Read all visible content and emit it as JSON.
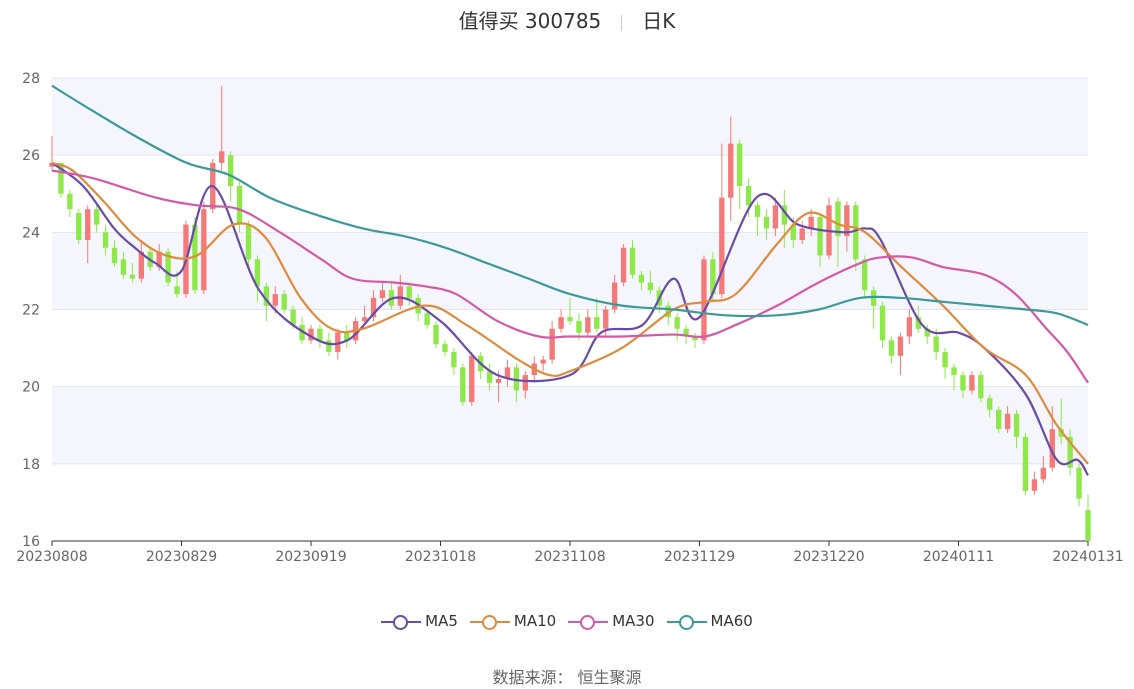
{
  "header": {
    "title": "值得买 300785",
    "period": "日K"
  },
  "source_text": "数据来源： 恒生聚源",
  "colors": {
    "up": "#f47a7a",
    "down": "#8ee84a",
    "MA5": "#6a4aa8",
    "MA10": "#e08a3c",
    "MA30": "#d45aa8",
    "MA60": "#3a9a9a"
  },
  "chart_data": {
    "type": "candlestick",
    "ylim": [
      16,
      28
    ],
    "y_ticks": [
      "16",
      "18",
      "20",
      "22",
      "24",
      "26",
      "28"
    ],
    "x_ticks": [
      "20230808",
      "20230829",
      "20230919",
      "20231018",
      "20231108",
      "20231129",
      "20231220",
      "20240111",
      "20240131"
    ],
    "grid": "horizontal bands",
    "legend": [
      "MA5",
      "MA10",
      "MA30",
      "MA60"
    ],
    "legend_position": "bottom",
    "candles": [
      [
        25.7,
        25.8,
        26.5,
        25.6
      ],
      [
        25.8,
        25.0,
        25.8,
        24.9
      ],
      [
        25.0,
        24.6,
        25.1,
        24.4
      ],
      [
        24.5,
        23.8,
        24.6,
        23.7
      ],
      [
        23.8,
        24.6,
        24.7,
        23.2
      ],
      [
        24.6,
        24.2,
        24.7,
        24.0
      ],
      [
        24.0,
        23.6,
        24.2,
        23.4
      ],
      [
        23.6,
        23.2,
        23.8,
        23.1
      ],
      [
        23.3,
        22.9,
        23.5,
        22.8
      ],
      [
        22.9,
        22.8,
        23.2,
        22.7
      ],
      [
        22.8,
        23.5,
        23.8,
        22.7
      ],
      [
        23.5,
        23.1,
        23.6,
        23.0
      ],
      [
        23.1,
        23.5,
        23.7,
        23.0
      ],
      [
        23.5,
        22.7,
        23.6,
        22.6
      ],
      [
        22.6,
        22.4,
        23.0,
        22.3
      ],
      [
        22.4,
        24.2,
        24.3,
        22.3
      ],
      [
        24.2,
        22.5,
        24.4,
        22.4
      ],
      [
        22.5,
        24.6,
        24.8,
        22.4
      ],
      [
        24.6,
        25.8,
        25.9,
        24.5
      ],
      [
        25.8,
        26.1,
        27.8,
        25.6
      ],
      [
        26.0,
        25.2,
        26.1,
        24.8
      ],
      [
        25.2,
        24.2,
        25.3,
        24.0
      ],
      [
        24.2,
        23.3,
        24.3,
        23.1
      ],
      [
        23.3,
        22.6,
        23.4,
        22.2
      ],
      [
        22.6,
        22.1,
        22.7,
        21.7
      ],
      [
        22.1,
        22.4,
        22.6,
        21.9
      ],
      [
        22.4,
        22.0,
        22.5,
        21.9
      ],
      [
        22.0,
        21.6,
        22.1,
        21.5
      ],
      [
        21.6,
        21.2,
        21.8,
        21.1
      ],
      [
        21.2,
        21.5,
        21.6,
        21.1
      ],
      [
        21.5,
        21.2,
        21.6,
        21.0
      ],
      [
        21.2,
        20.9,
        21.4,
        20.8
      ],
      [
        20.9,
        21.4,
        21.5,
        20.7
      ],
      [
        21.4,
        21.2,
        21.6,
        21.0
      ],
      [
        21.2,
        21.7,
        21.8,
        21.1
      ],
      [
        21.7,
        21.8,
        22.1,
        21.6
      ],
      [
        21.8,
        22.3,
        22.5,
        21.7
      ],
      [
        22.3,
        22.5,
        22.7,
        22.2
      ],
      [
        22.5,
        22.1,
        22.7,
        22.0
      ],
      [
        22.1,
        22.6,
        22.9,
        22.0
      ],
      [
        22.6,
        22.3,
        22.7,
        22.1
      ],
      [
        22.3,
        21.9,
        22.4,
        21.7
      ],
      [
        21.9,
        21.6,
        22.0,
        21.5
      ],
      [
        21.6,
        21.1,
        21.7,
        21.0
      ],
      [
        21.1,
        20.9,
        21.2,
        20.8
      ],
      [
        20.9,
        20.5,
        21.0,
        20.3
      ],
      [
        20.5,
        19.6,
        20.6,
        19.5
      ],
      [
        19.6,
        20.8,
        20.9,
        19.5
      ],
      [
        20.8,
        20.4,
        20.9,
        20.2
      ],
      [
        20.4,
        20.1,
        20.6,
        19.9
      ],
      [
        20.1,
        20.2,
        20.4,
        19.6
      ],
      [
        20.2,
        20.5,
        20.7,
        20.0
      ],
      [
        20.5,
        19.9,
        20.6,
        19.6
      ],
      [
        19.9,
        20.3,
        20.4,
        19.7
      ],
      [
        20.3,
        20.6,
        20.8,
        20.1
      ],
      [
        20.6,
        20.7,
        20.8,
        20.4
      ],
      [
        20.7,
        21.5,
        21.7,
        20.6
      ],
      [
        21.5,
        21.8,
        22.0,
        21.4
      ],
      [
        21.8,
        21.7,
        22.3,
        21.6
      ],
      [
        21.7,
        21.4,
        21.9,
        21.2
      ],
      [
        21.4,
        21.8,
        22.0,
        21.3
      ],
      [
        21.8,
        21.5,
        22.3,
        21.4
      ],
      [
        21.5,
        22.0,
        22.1,
        21.3
      ],
      [
        22.0,
        22.7,
        22.9,
        21.9
      ],
      [
        22.7,
        23.6,
        23.7,
        22.6
      ],
      [
        23.6,
        22.9,
        23.8,
        22.8
      ],
      [
        22.9,
        22.7,
        23.0,
        22.5
      ],
      [
        22.7,
        22.5,
        23.0,
        22.4
      ],
      [
        22.5,
        22.1,
        22.6,
        21.9
      ],
      [
        22.1,
        21.8,
        22.2,
        21.6
      ],
      [
        21.8,
        21.5,
        21.9,
        21.2
      ],
      [
        21.5,
        21.3,
        21.6,
        21.1
      ],
      [
        21.3,
        21.2,
        21.4,
        21.0
      ],
      [
        21.2,
        23.3,
        23.4,
        21.1
      ],
      [
        23.3,
        22.4,
        23.5,
        22.2
      ],
      [
        22.4,
        24.9,
        26.3,
        22.3
      ],
      [
        24.9,
        26.3,
        27.0,
        24.3
      ],
      [
        26.3,
        25.2,
        26.4,
        24.6
      ],
      [
        25.2,
        24.7,
        25.4,
        24.4
      ],
      [
        24.7,
        24.4,
        24.8,
        23.9
      ],
      [
        24.4,
        24.1,
        24.6,
        23.8
      ],
      [
        24.1,
        24.7,
        24.9,
        23.9
      ],
      [
        24.7,
        24.2,
        25.1,
        23.6
      ],
      [
        24.2,
        23.8,
        24.4,
        23.6
      ],
      [
        23.8,
        24.1,
        24.3,
        23.7
      ],
      [
        24.1,
        24.4,
        24.6,
        23.9
      ],
      [
        24.4,
        23.4,
        24.5,
        23.1
      ],
      [
        23.4,
        24.7,
        24.9,
        23.3
      ],
      [
        24.8,
        23.9,
        24.9,
        23.1
      ],
      [
        23.9,
        24.7,
        24.8,
        23.5
      ],
      [
        24.7,
        23.3,
        24.8,
        23.0
      ],
      [
        23.3,
        22.5,
        23.4,
        22.3
      ],
      [
        22.5,
        22.1,
        22.6,
        21.5
      ],
      [
        22.1,
        21.2,
        22.2,
        21.0
      ],
      [
        21.2,
        20.8,
        21.3,
        20.6
      ],
      [
        20.8,
        21.3,
        21.4,
        20.3
      ],
      [
        21.3,
        21.8,
        22.0,
        21.1
      ],
      [
        21.8,
        21.5,
        22.1,
        21.4
      ],
      [
        21.5,
        21.3,
        21.6,
        21.1
      ],
      [
        21.3,
        20.9,
        21.5,
        20.7
      ],
      [
        20.9,
        20.5,
        21.0,
        20.2
      ],
      [
        20.5,
        20.3,
        20.6,
        19.9
      ],
      [
        20.3,
        19.9,
        20.4,
        19.7
      ],
      [
        19.9,
        20.3,
        20.4,
        19.8
      ],
      [
        20.3,
        19.7,
        20.4,
        19.6
      ],
      [
        19.7,
        19.4,
        19.8,
        19.2
      ],
      [
        19.4,
        18.9,
        19.5,
        18.8
      ],
      [
        18.9,
        19.3,
        19.5,
        18.8
      ],
      [
        19.3,
        18.7,
        19.4,
        18.4
      ],
      [
        18.7,
        17.3,
        18.8,
        17.2
      ],
      [
        17.3,
        17.6,
        17.8,
        17.2
      ],
      [
        17.6,
        17.9,
        18.2,
        17.5
      ],
      [
        17.9,
        18.9,
        19.5,
        17.8
      ],
      [
        18.9,
        18.7,
        19.7,
        18.5
      ],
      [
        18.7,
        17.9,
        18.9,
        17.7
      ],
      [
        17.9,
        17.1,
        18.0,
        16.9
      ],
      [
        16.8,
        16.0,
        17.2,
        16.0
      ]
    ],
    "series": [
      {
        "name": "MA5",
        "values": [
          [
            0,
            25.8
          ],
          [
            0.03,
            25.2
          ],
          [
            0.06,
            24.1
          ],
          [
            0.08,
            23.6
          ],
          [
            0.1,
            23.2
          ],
          [
            0.125,
            23.0
          ],
          [
            0.155,
            25.2
          ],
          [
            0.2,
            22.5
          ],
          [
            0.25,
            21.3
          ],
          [
            0.285,
            21.2
          ],
          [
            0.33,
            22.3
          ],
          [
            0.375,
            21.7
          ],
          [
            0.43,
            20.3
          ],
          [
            0.5,
            20.3
          ],
          [
            0.53,
            21.4
          ],
          [
            0.57,
            21.6
          ],
          [
            0.6,
            22.8
          ],
          [
            0.625,
            21.8
          ],
          [
            0.68,
            24.9
          ],
          [
            0.72,
            24.2
          ],
          [
            0.765,
            24.0
          ],
          [
            0.785,
            24.1
          ],
          [
            0.8,
            23.8
          ],
          [
            0.84,
            21.6
          ],
          [
            0.875,
            21.4
          ],
          [
            0.9,
            21.0
          ],
          [
            0.94,
            19.8
          ],
          [
            0.97,
            18.1
          ],
          [
            0.99,
            18.1
          ],
          [
            1.0,
            17.7
          ]
        ]
      },
      {
        "name": "MA10",
        "values": [
          [
            0,
            25.8
          ],
          [
            0.02,
            25.6
          ],
          [
            0.05,
            24.8
          ],
          [
            0.08,
            23.9
          ],
          [
            0.11,
            23.4
          ],
          [
            0.14,
            23.4
          ],
          [
            0.175,
            24.2
          ],
          [
            0.205,
            23.9
          ],
          [
            0.24,
            22.3
          ],
          [
            0.27,
            21.5
          ],
          [
            0.3,
            21.5
          ],
          [
            0.36,
            22.1
          ],
          [
            0.4,
            21.6
          ],
          [
            0.45,
            20.7
          ],
          [
            0.48,
            20.3
          ],
          [
            0.5,
            20.4
          ],
          [
            0.55,
            21.0
          ],
          [
            0.6,
            22.0
          ],
          [
            0.63,
            22.2
          ],
          [
            0.66,
            22.4
          ],
          [
            0.7,
            23.7
          ],
          [
            0.73,
            24.5
          ],
          [
            0.76,
            24.2
          ],
          [
            0.785,
            24.0
          ],
          [
            0.82,
            23.1
          ],
          [
            0.86,
            22.1
          ],
          [
            0.9,
            21.0
          ],
          [
            0.94,
            20.3
          ],
          [
            0.97,
            19.0
          ],
          [
            1.0,
            18.0
          ]
        ]
      },
      {
        "name": "MA30",
        "values": [
          [
            0,
            25.6
          ],
          [
            0.04,
            25.4
          ],
          [
            0.1,
            24.9
          ],
          [
            0.14,
            24.7
          ],
          [
            0.18,
            24.6
          ],
          [
            0.22,
            24.0
          ],
          [
            0.26,
            23.3
          ],
          [
            0.29,
            22.8
          ],
          [
            0.33,
            22.7
          ],
          [
            0.36,
            22.6
          ],
          [
            0.39,
            22.4
          ],
          [
            0.43,
            21.7
          ],
          [
            0.47,
            21.3
          ],
          [
            0.5,
            21.3
          ],
          [
            0.55,
            21.3
          ],
          [
            0.6,
            21.35
          ],
          [
            0.63,
            21.3
          ],
          [
            0.66,
            21.6
          ],
          [
            0.7,
            22.1
          ],
          [
            0.74,
            22.7
          ],
          [
            0.78,
            23.2
          ],
          [
            0.8,
            23.35
          ],
          [
            0.83,
            23.35
          ],
          [
            0.86,
            23.1
          ],
          [
            0.9,
            22.9
          ],
          [
            0.93,
            22.4
          ],
          [
            0.96,
            21.5
          ],
          [
            0.98,
            20.9
          ],
          [
            1.0,
            20.1
          ]
        ]
      },
      {
        "name": "MA60",
        "values": [
          [
            0,
            27.8
          ],
          [
            0.03,
            27.3
          ],
          [
            0.08,
            26.5
          ],
          [
            0.13,
            25.8
          ],
          [
            0.17,
            25.5
          ],
          [
            0.21,
            24.9
          ],
          [
            0.25,
            24.5
          ],
          [
            0.3,
            24.1
          ],
          [
            0.34,
            23.9
          ],
          [
            0.38,
            23.6
          ],
          [
            0.42,
            23.2
          ],
          [
            0.46,
            22.8
          ],
          [
            0.5,
            22.4
          ],
          [
            0.55,
            22.1
          ],
          [
            0.6,
            22.0
          ],
          [
            0.65,
            21.85
          ],
          [
            0.7,
            21.85
          ],
          [
            0.74,
            22.0
          ],
          [
            0.78,
            22.3
          ],
          [
            0.82,
            22.3
          ],
          [
            0.86,
            22.2
          ],
          [
            0.9,
            22.1
          ],
          [
            0.94,
            22.0
          ],
          [
            0.97,
            21.9
          ],
          [
            1.0,
            21.6
          ]
        ]
      }
    ]
  }
}
